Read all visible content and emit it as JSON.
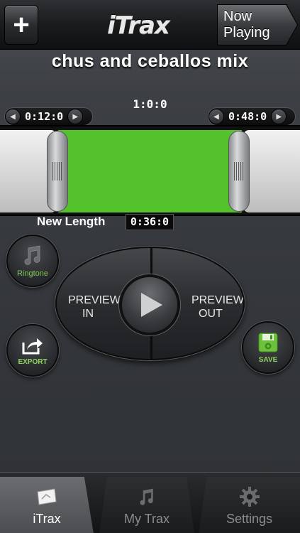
{
  "topbar": {
    "logo": "iTrax",
    "now_playing_label": "Now Playing"
  },
  "track": {
    "title": "chus and ceballos mix",
    "total_time": "1:0:0",
    "start_time": "0:12:0",
    "end_time": "0:48:0",
    "new_length_label": "New Length",
    "new_length_value": "0:36:0",
    "selection_color": "#54c22c"
  },
  "controls": {
    "ringtone_label": "Ringtone",
    "export_label": "EXPORT",
    "save_label": "SAVE",
    "preview_in_line1": "PREVIEW",
    "preview_in_line2": "IN",
    "preview_out_line1": "PREVIEW",
    "preview_out_line2": "OUT"
  },
  "tabs": [
    {
      "label": "iTrax",
      "icon": "itrax-card-icon",
      "active": true
    },
    {
      "label": "My Trax",
      "icon": "music-note-icon",
      "active": false
    },
    {
      "label": "Settings",
      "icon": "gear-icon",
      "active": false
    }
  ],
  "colors": {
    "accent_green": "#7fc84f"
  }
}
